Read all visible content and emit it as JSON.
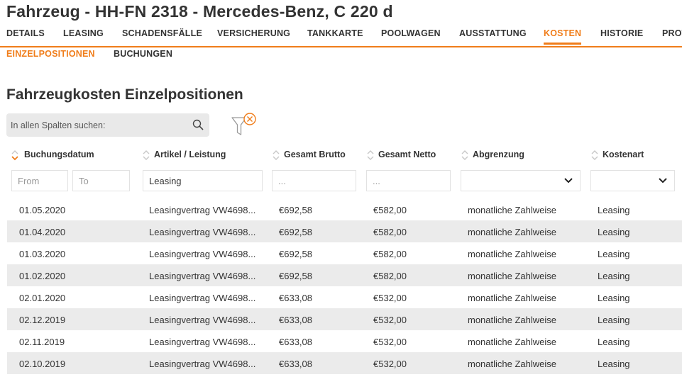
{
  "page": {
    "title": "Fahrzeug - HH-FN 2318 - Mercedes-Benz, C 220 d"
  },
  "tabs": [
    {
      "label": "DETAILS"
    },
    {
      "label": "LEASING"
    },
    {
      "label": "SCHADENSFÄLLE"
    },
    {
      "label": "VERSICHERUNG"
    },
    {
      "label": "TANKKARTE"
    },
    {
      "label": "POOLWAGEN"
    },
    {
      "label": "AUSSTATTUNG"
    },
    {
      "label": "KOSTEN",
      "active": true
    },
    {
      "label": "HISTORIE"
    },
    {
      "label": "PROT"
    }
  ],
  "subtabs": [
    {
      "label": "EINZELPOSITIONEN",
      "active": true
    },
    {
      "label": "BUCHUNGEN"
    }
  ],
  "section": {
    "heading": "Fahrzeugkosten Einzelpositionen"
  },
  "search": {
    "placeholder": "In allen Spalten suchen:"
  },
  "icons": {
    "search": "search-icon",
    "filter_reset": "filter-reset-icon",
    "sort": "sort-icon",
    "dropdown": "chevron-down-icon"
  },
  "colors": {
    "accent": "#f07d1a",
    "row_alt": "#ebebeb",
    "input_bg": "#e9e9e9"
  },
  "table": {
    "columns": [
      {
        "label": "Buchungsdatum",
        "sorted": "asc"
      },
      {
        "label": "Artikel / Leistung"
      },
      {
        "label": "Gesamt Brutto"
      },
      {
        "label": "Gesamt Netto"
      },
      {
        "label": "Abgrenzung"
      },
      {
        "label": "Kostenart"
      }
    ],
    "filters": {
      "date_from_placeholder": "From",
      "date_to_placeholder": "To",
      "artikel_value": "Leasing",
      "brutto_placeholder": "...",
      "netto_placeholder": "...",
      "abgrenzung_value": "",
      "kostenart_value": ""
    },
    "rows": [
      {
        "date": "01.05.2020",
        "artikel": "Leasingvertrag VW4698...",
        "brutto": "€692,58",
        "netto": "€582,00",
        "abgrenzung": "monatliche Zahlweise",
        "kostenart": "Leasing"
      },
      {
        "date": "01.04.2020",
        "artikel": "Leasingvertrag VW4698...",
        "brutto": "€692,58",
        "netto": "€582,00",
        "abgrenzung": "monatliche Zahlweise",
        "kostenart": "Leasing"
      },
      {
        "date": "01.03.2020",
        "artikel": "Leasingvertrag VW4698...",
        "brutto": "€692,58",
        "netto": "€582,00",
        "abgrenzung": "monatliche Zahlweise",
        "kostenart": "Leasing"
      },
      {
        "date": "01.02.2020",
        "artikel": "Leasingvertrag VW4698...",
        "brutto": "€692,58",
        "netto": "€582,00",
        "abgrenzung": "monatliche Zahlweise",
        "kostenart": "Leasing"
      },
      {
        "date": "02.01.2020",
        "artikel": "Leasingvertrag VW4698...",
        "brutto": "€633,08",
        "netto": "€532,00",
        "abgrenzung": "monatliche Zahlweise",
        "kostenart": "Leasing"
      },
      {
        "date": "02.12.2019",
        "artikel": "Leasingvertrag VW4698...",
        "brutto": "€633,08",
        "netto": "€532,00",
        "abgrenzung": "monatliche Zahlweise",
        "kostenart": "Leasing"
      },
      {
        "date": "02.11.2019",
        "artikel": "Leasingvertrag VW4698...",
        "brutto": "€633,08",
        "netto": "€532,00",
        "abgrenzung": "monatliche Zahlweise",
        "kostenart": "Leasing"
      },
      {
        "date": "02.10.2019",
        "artikel": "Leasingvertrag VW4698...",
        "brutto": "€633,08",
        "netto": "€532,00",
        "abgrenzung": "monatliche Zahlweise",
        "kostenart": "Leasing"
      }
    ]
  }
}
